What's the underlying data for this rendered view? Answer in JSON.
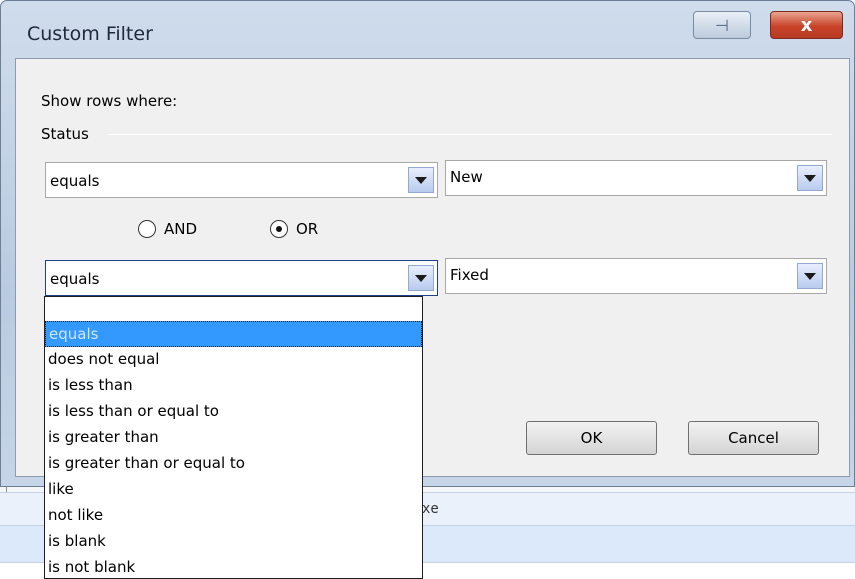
{
  "background": {
    "partial_header": "xe"
  },
  "window": {
    "title": "Custom Filter",
    "pin_glyph": "⊣",
    "close_glyph": "x"
  },
  "dialog": {
    "show_rows_label": "Show rows where:",
    "field_label": "Status",
    "row1": {
      "operator": "equals",
      "value": "New"
    },
    "logic": {
      "and_label": "AND",
      "or_label": "OR",
      "selected": "OR"
    },
    "row2": {
      "operator": "equals",
      "value": "Fixed"
    },
    "ok_label": "OK",
    "cancel_label": "Cancel"
  },
  "dropdown": {
    "options": [
      "equals",
      "does not equal",
      "is less than",
      "is less than or equal to",
      "is greater than",
      "is greater than or equal to",
      "like",
      "not like",
      "is blank",
      "is not blank"
    ],
    "selected_index": 0
  },
  "icons": {
    "dropdown_arrow": "chevron-down-icon",
    "pin": "pin-icon",
    "close": "close-icon"
  },
  "colors": {
    "selection": "#3399ff",
    "close_button": "#c8432a",
    "dialog_bg": "#f0f0f0"
  }
}
